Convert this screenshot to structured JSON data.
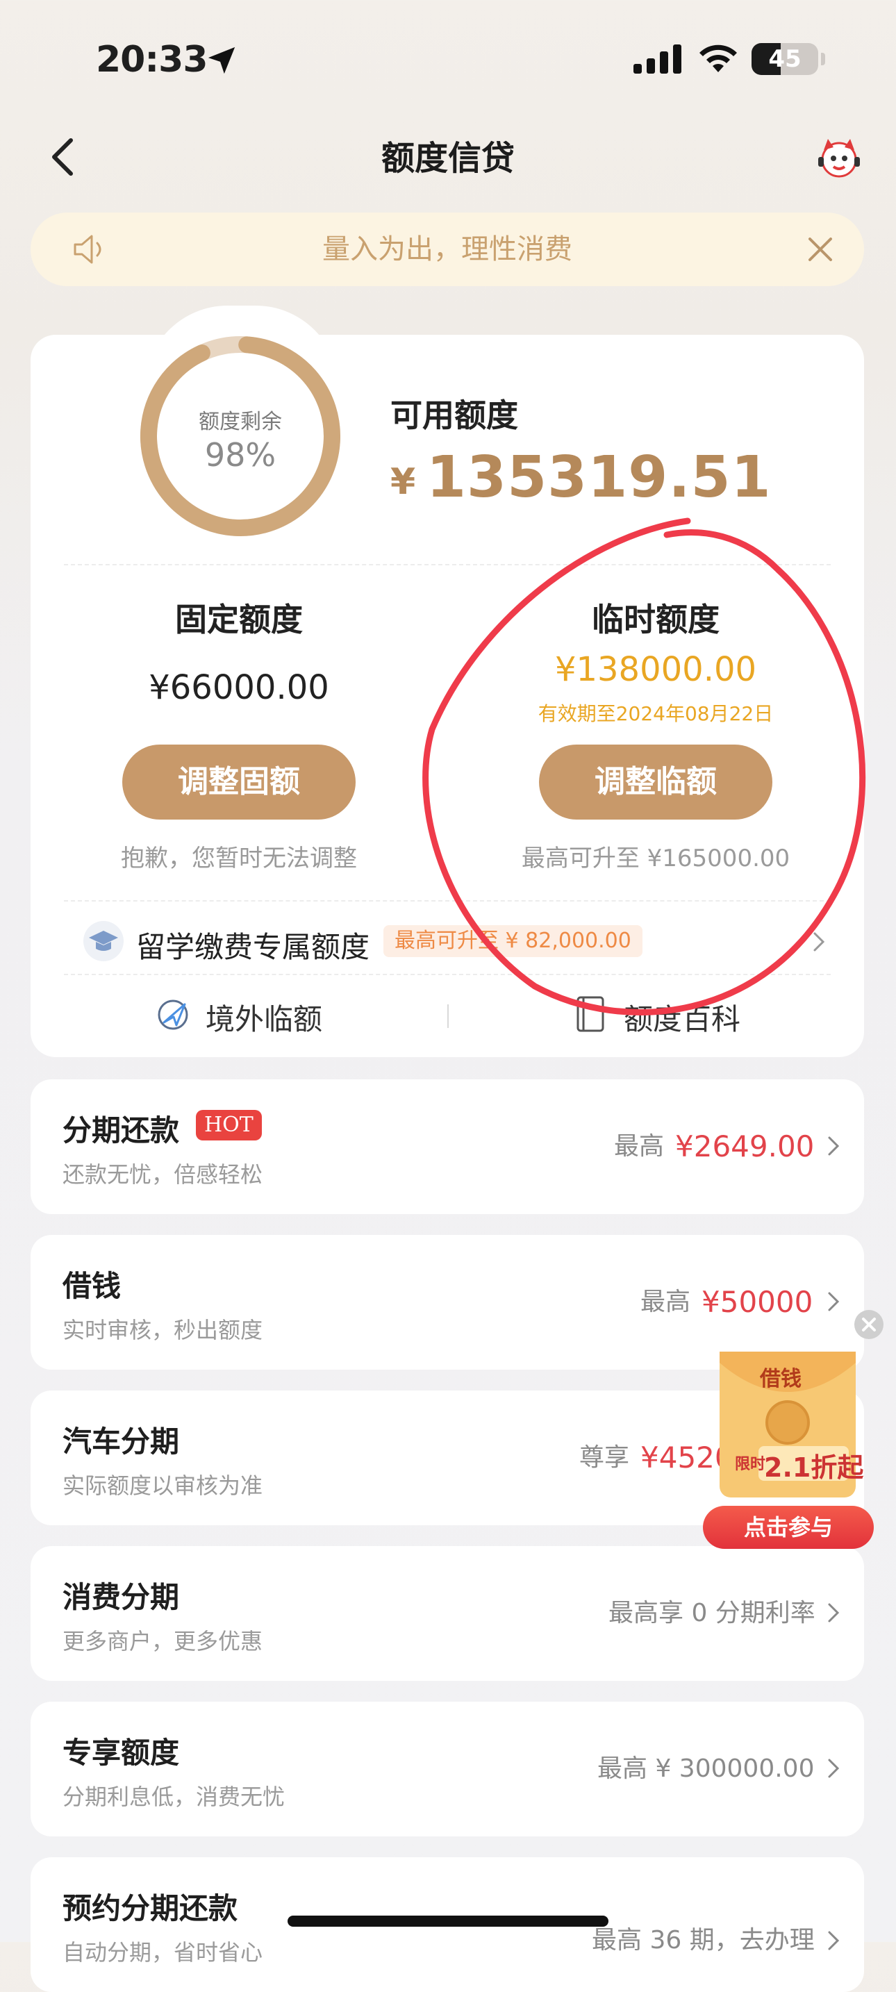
{
  "status_bar": {
    "time": "20:33",
    "battery": "45"
  },
  "nav": {
    "title": "额度信贷"
  },
  "notice": {
    "text": "量入为出，理性消费"
  },
  "credit": {
    "remaining_label": "额度剩余",
    "remaining_pct": "98%",
    "remaining_fraction": 0.98,
    "available_label": "可用额度",
    "currency": "¥",
    "available_amount": "135319.51",
    "fixed": {
      "title": "固定额度",
      "amount": "¥66000.00",
      "button": "调整固额",
      "note": "抱歉，您暂时无法调整"
    },
    "temporary": {
      "title": "临时额度",
      "amount": "¥138000.00",
      "expiry": "有效期至2024年08月22日",
      "button": "调整临额",
      "note": "最高可升至 ¥165000.00"
    },
    "study": {
      "label": "留学缴费专属额度",
      "badge": "最高可升至 ¥ 82,000.00"
    },
    "links": {
      "overseas": "境外临额",
      "encyclopedia": "额度百科"
    }
  },
  "items": [
    {
      "title": "分期还款",
      "badge": "HOT",
      "subtitle": "还款无忧，倍感轻松",
      "right_label": "最高",
      "right_value": "¥2649.00"
    },
    {
      "title": "借钱",
      "subtitle": "实时审核，秒出额度",
      "right_label": "最高",
      "right_value": "¥50000"
    },
    {
      "title": "汽车分期",
      "subtitle": "实际额度以审核为准",
      "right_label": "尊享",
      "right_value": "¥4520"
    },
    {
      "title": "消费分期",
      "subtitle": "更多商户，更多优惠",
      "right_label": "最高享 0 分期利率"
    },
    {
      "title": "专享额度",
      "subtitle": "分期利息低，消费无忧",
      "right_label": "最高 ¥ 300000.00"
    },
    {
      "title": "预约分期还款",
      "subtitle": "自动分期，省时省心",
      "right_label": "最高 36 期，去办理"
    }
  ],
  "promo": {
    "top": "借钱",
    "limited": "限时",
    "discount": "2.1折起",
    "button": "点击参与"
  },
  "colors": {
    "accent_gold": "#c8996a",
    "amount_gold": "#b5895a",
    "temp_orange": "#e9a623",
    "red": "#e2434a",
    "annotation_red": "#ef3b4a"
  }
}
